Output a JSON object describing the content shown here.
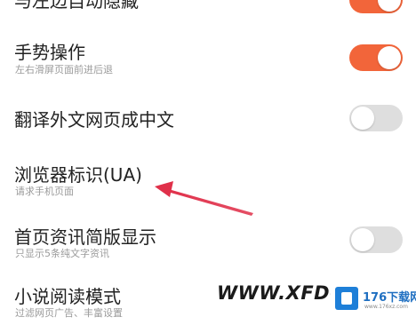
{
  "settings": [
    {
      "title": "与左边自动隐藏",
      "subtitle": "",
      "toggle": "on"
    },
    {
      "title": "手势操作",
      "subtitle": "左右滑屏页面前进后退",
      "toggle": "on"
    },
    {
      "title": "翻译外文网页成中文",
      "subtitle": "",
      "toggle": "off"
    },
    {
      "title": "浏览器标识(UA)",
      "subtitle": "请求手机页面",
      "toggle": null
    },
    {
      "title": "首页资讯简版显示",
      "subtitle": "只显示5条纯文字资讯",
      "toggle": "off"
    },
    {
      "title": "小说阅读模式",
      "subtitle": "过滤网页广告、丰富设置",
      "toggle": null
    }
  ],
  "colors": {
    "toggle_on": "#f2653a",
    "toggle_off": "#dedede",
    "annotation_arrow": "#e0304a"
  },
  "watermark": {
    "text": "WWW.XFDOW",
    "badge_label": "176下载网",
    "badge_url": "www.176xz.com"
  }
}
